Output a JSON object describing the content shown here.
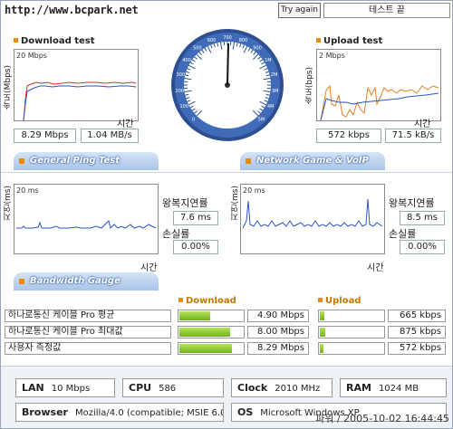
{
  "header": {
    "url": "http://www.bcpark.net",
    "try_again": "Try again",
    "end_test": "테스트 끝"
  },
  "download": {
    "title": "Download test",
    "y_label": "속도(Mbps)",
    "scale": "20 Mbps",
    "x_label": "시간",
    "speed_mbps": "8.29 Mbps",
    "speed_mbs": "1.04 MB/s"
  },
  "upload": {
    "title": "Upload test",
    "y_label": "속도(bps)",
    "scale": "2 Mbps",
    "x_label": "시간",
    "speed_kbps": "572 kbps",
    "speed_kbs": "71.5 kB/s"
  },
  "gauge": {
    "ticks": [
      "0",
      "100",
      "200",
      "300",
      "400",
      "500",
      "600",
      "700",
      "800",
      "900",
      "1M",
      "2M",
      "3M",
      "4M",
      "5M"
    ],
    "needle_value": "500"
  },
  "tabs": {
    "ping": "General Ping Test",
    "game": "Network Game & VoIP Test",
    "bandwidth": "Bandwidth Gauge"
  },
  "ping_general": {
    "y_label": "지연(ms)",
    "scale": "20 ms",
    "x_label": "시간",
    "rtt_label": "왕복지연률",
    "rtt_value": "7.6 ms",
    "loss_label": "손실률",
    "loss_value": "0.00%"
  },
  "ping_game": {
    "y_label": "지연(ms)",
    "scale": "20 ms",
    "x_label": "시간",
    "rtt_label": "왕복지연률",
    "rtt_value": "8.5 ms",
    "loss_label": "손실률",
    "loss_value": "0.00%"
  },
  "bandwidth": {
    "download_title": "Download",
    "upload_title": "Upload",
    "rows": [
      {
        "label": "하나로통신 케이블 Pro 평균",
        "download": "4.90 Mbps",
        "download_fill": 0.49,
        "upload": "665 kbps",
        "upload_fill": 0.07
      },
      {
        "label": "하나로통신 케이블 Pro 최대값",
        "download": "8.00 Mbps",
        "download_fill": 0.8,
        "upload": "875 kbps",
        "upload_fill": 0.09
      },
      {
        "label": "사용자 측정값",
        "download": "8.29 Mbps",
        "download_fill": 0.83,
        "upload": "572 kbps",
        "upload_fill": 0.06
      }
    ]
  },
  "system": {
    "lan_label": "LAN",
    "lan_value": "10 Mbps",
    "cpu_label": "CPU",
    "cpu_value": "586",
    "clock_label": "Clock",
    "clock_value": "2010 MHz",
    "ram_label": "RAM",
    "ram_value": "1024 MB",
    "browser_label": "Browser",
    "browser_value": "Mozilla/4.0 (compatible; MSIE 6.0",
    "os_label": "OS",
    "os_value": "Microsoft Windows XP"
  },
  "watermark": "파워 / 2005-10-02 16:44:45",
  "colors": {
    "accent": "#f08a00",
    "graph_blue": "#2b55c8",
    "graph_red": "#d03030",
    "bar_green": "#7fbf2a"
  }
}
